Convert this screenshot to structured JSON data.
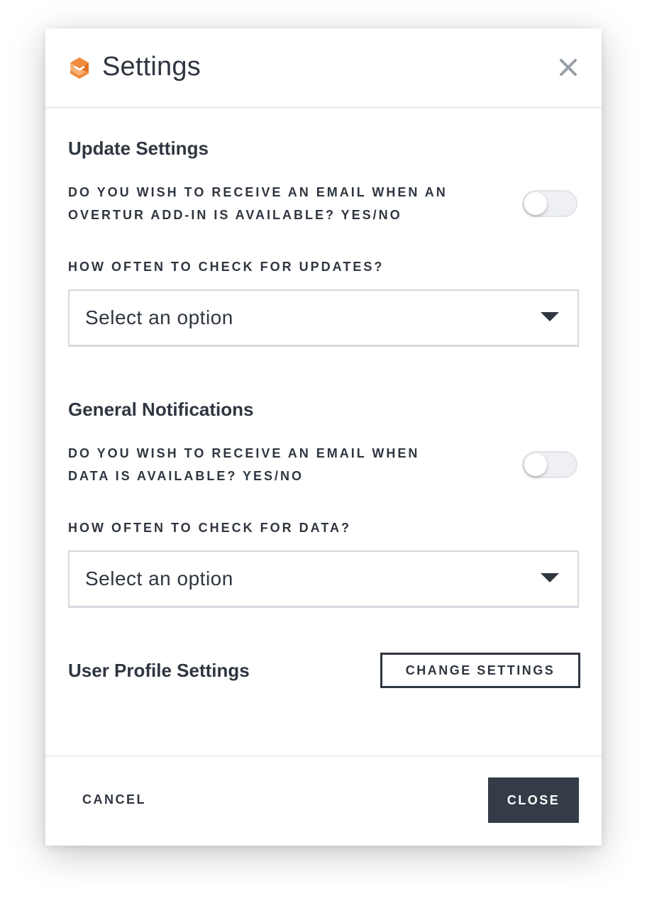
{
  "dialog": {
    "title": "Settings",
    "close_icon": "close-icon",
    "logo_icon": "overtur-logo-icon",
    "brand_color": "#f0883e"
  },
  "update_settings": {
    "heading": "Update Settings",
    "email_question": "DO YOU WISH TO RECEIVE AN EMAIL WHEN AN OVERTUR ADD-IN IS AVAILABLE? YES/NO",
    "email_toggle_on": false,
    "frequency_label": "HOW OFTEN TO CHECK FOR UPDATES?",
    "frequency_value": "Select an option"
  },
  "general_notifications": {
    "heading": "General Notifications",
    "email_question": "DO YOU WISH TO RECEIVE AN EMAIL WHEN DATA IS AVAILABLE? YES/NO",
    "email_toggle_on": false,
    "frequency_label": "HOW OFTEN TO CHECK FOR DATA?",
    "frequency_value": "Select an option"
  },
  "user_profile": {
    "heading": "User Profile Settings",
    "change_button": "CHANGE SETTINGS"
  },
  "footer": {
    "cancel_label": "CANCEL",
    "close_label": "CLOSE",
    "close_button_color": "#343c47"
  }
}
